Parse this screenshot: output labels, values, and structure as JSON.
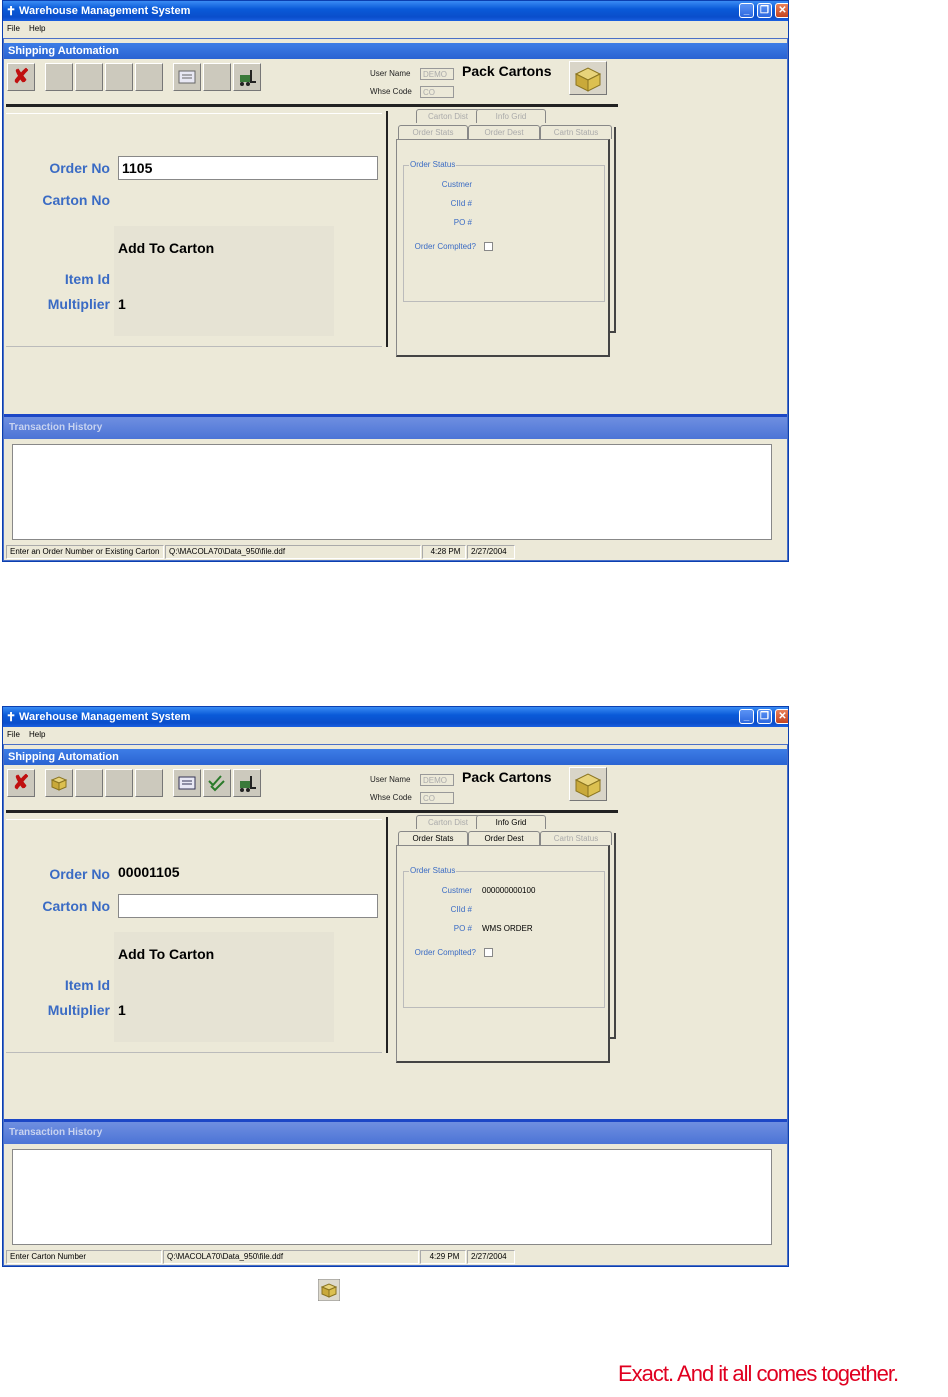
{
  "screens": [
    {
      "title": "Warehouse Management System",
      "menu": [
        "File",
        "Help"
      ],
      "subtitle": "Shipping Automation",
      "user_name_label": "User Name",
      "user_name_value": "DEMO",
      "whse_code_label": "Whse Code",
      "whse_code_value": "CO",
      "mode_title": "Pack Cartons",
      "order_no_label": "Order No",
      "order_no_value": "1105",
      "carton_no_label": "Carton No",
      "carton_no_value": "",
      "add_to_carton_label": "Add To Carton",
      "item_id_label": "Item Id",
      "multiplier_label": "Multiplier",
      "multiplier_value": "1",
      "tabs_row1": [
        "Carton Dist",
        "Info Grid"
      ],
      "tabs_row2": [
        "Order Stats",
        "Order Dest",
        "Cartn Status"
      ],
      "group_title": "Order Status",
      "customer_label": "Custmer",
      "customer_value": "",
      "cust_id_label": "CIId #",
      "cust_id_value": "",
      "po_label": "PO #",
      "po_value": "",
      "order_completed_label": "Order Complted?",
      "history_title": "Transaction History",
      "status": [
        "Enter an Order Number or Existing Carton",
        "Q:\\MACOLA70\\Data_950\\file.ddf",
        "4:28 PM",
        "2/27/2004"
      ]
    },
    {
      "title": "Warehouse Management System",
      "menu": [
        "File",
        "Help"
      ],
      "subtitle": "Shipping Automation",
      "user_name_label": "User Name",
      "user_name_value": "DEMO",
      "whse_code_label": "Whse Code",
      "whse_code_value": "CO",
      "mode_title": "Pack Cartons",
      "order_no_label": "Order No",
      "order_no_value": "00001105",
      "carton_no_label": "Carton No",
      "carton_no_value": "",
      "add_to_carton_label": "Add To Carton",
      "item_id_label": "Item Id",
      "multiplier_label": "Multiplier",
      "multiplier_value": "1",
      "tabs_row1": [
        "Carton Dist",
        "Info Grid"
      ],
      "tabs_row2": [
        "Order Stats",
        "Order Dest",
        "Cartn Status"
      ],
      "group_title": "Order Status",
      "customer_label": "Custmer",
      "customer_value": "000000000100",
      "cust_id_label": "CIId #",
      "cust_id_value": "",
      "po_label": "PO #",
      "po_value": "WMS ORDER",
      "order_completed_label": "Order Complted?",
      "history_title": "Transaction History",
      "status": [
        "Enter Carton Number",
        "Q:\\MACOLA70\\Data_950\\file.ddf",
        "4:29 PM",
        "2/27/2004"
      ]
    }
  ],
  "caption": "Exact. And it all comes together.",
  "colors": {
    "accent_red": "#e00020",
    "title_blue": "#0a5ad8",
    "label_blue": "#3a6bc4"
  }
}
